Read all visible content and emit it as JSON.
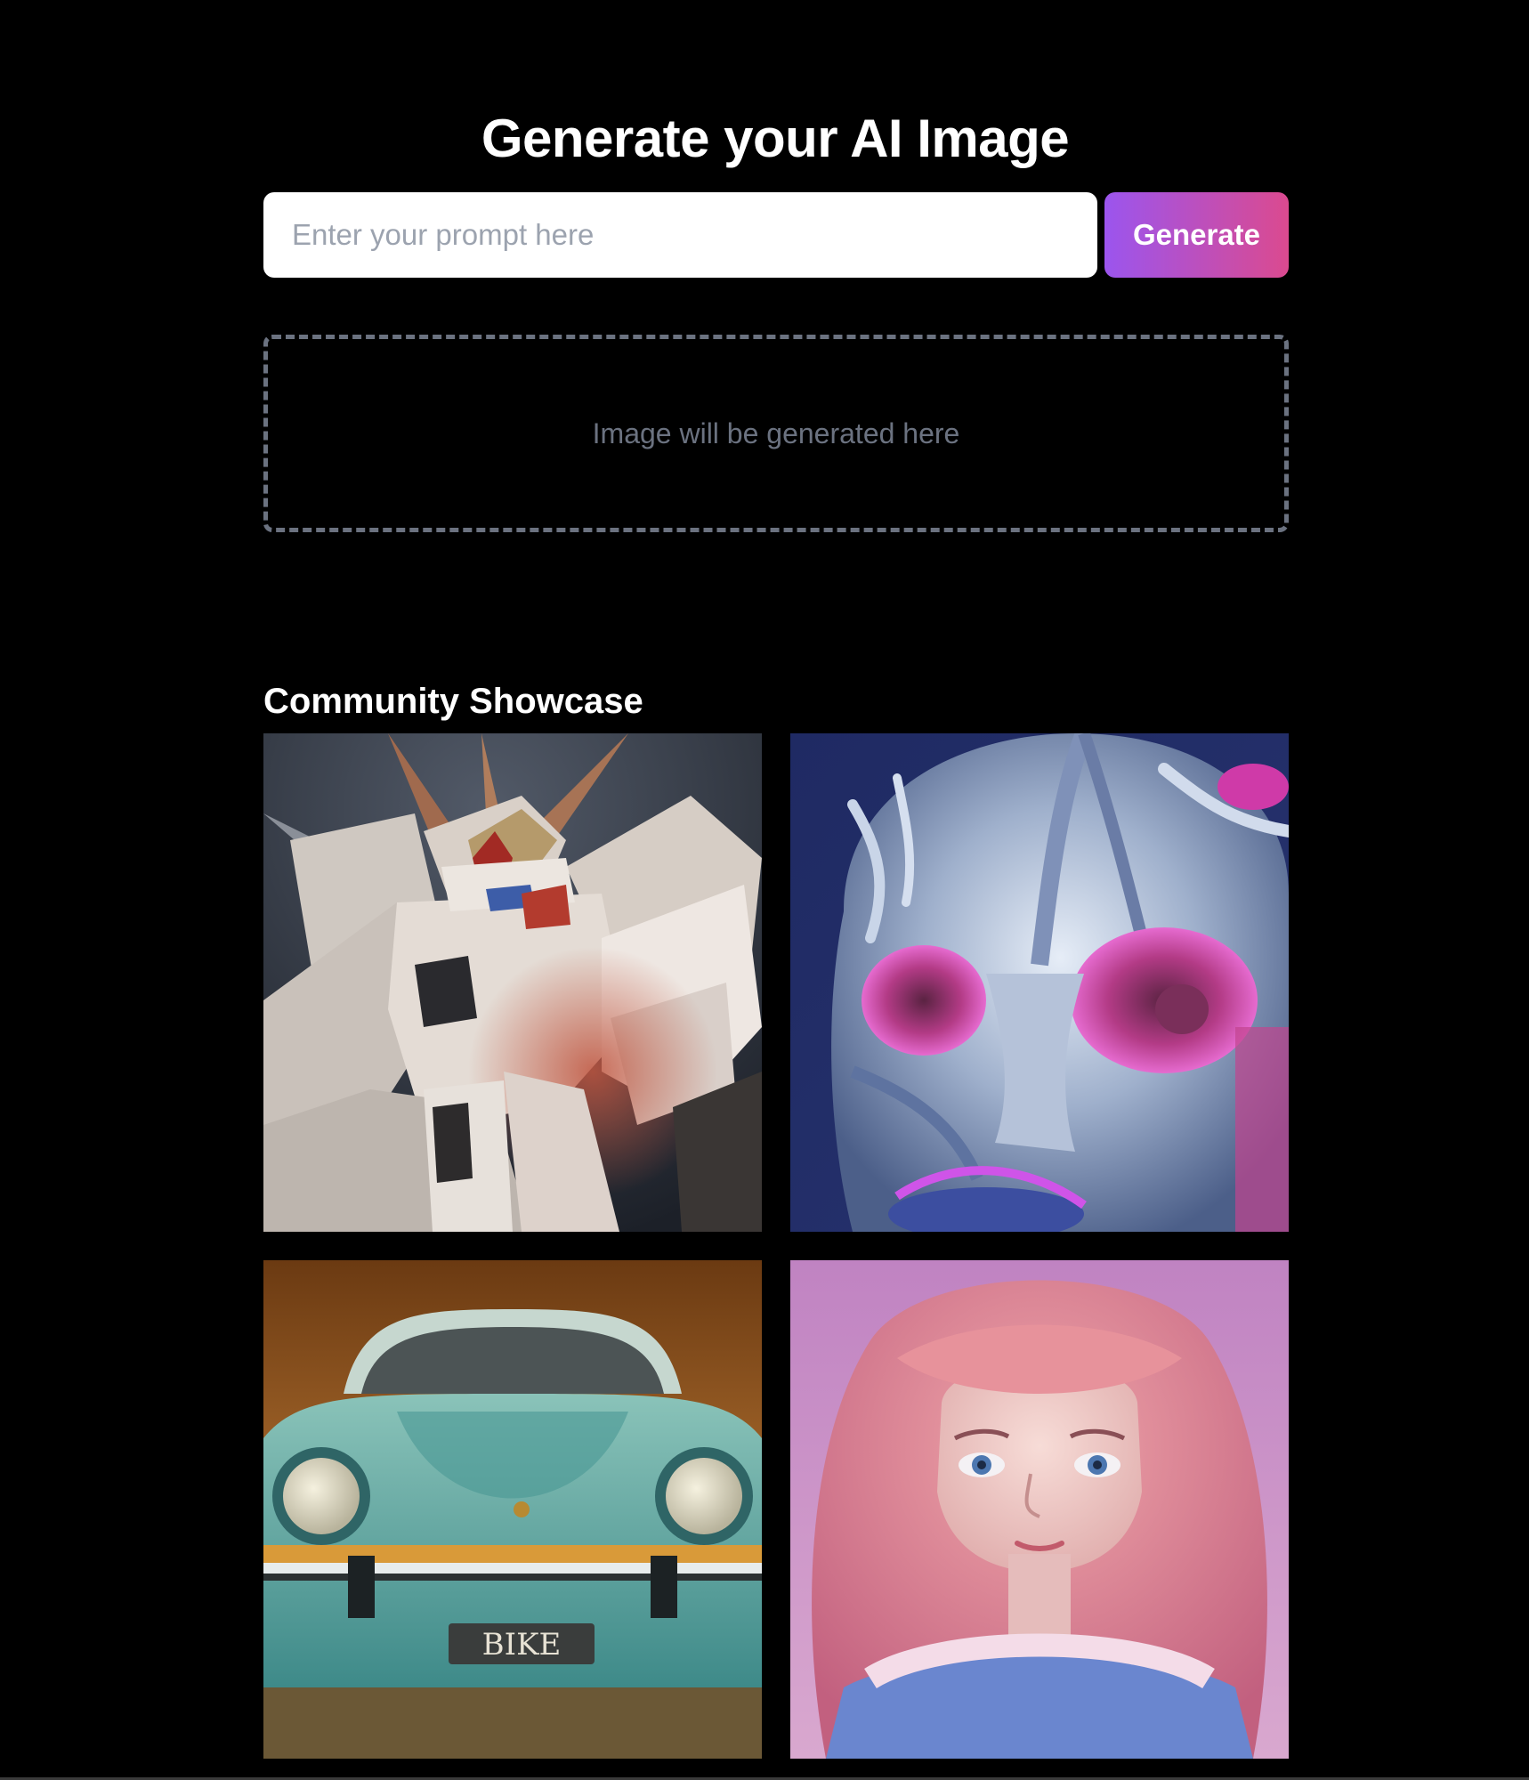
{
  "header": {
    "title": "Generate your AI Image"
  },
  "prompt": {
    "placeholder": "Enter your prompt here",
    "value": "",
    "button_label": "Generate"
  },
  "output": {
    "placeholder_text": "Image will be generated here"
  },
  "showcase": {
    "title": "Community Showcase",
    "items": [
      {
        "subject": "mecha robot"
      },
      {
        "subject": "chrome alien mask"
      },
      {
        "subject": "teal classic sports car",
        "plate_text": "BIKE"
      },
      {
        "subject": "pink-haired girl portrait"
      }
    ]
  },
  "colors": {
    "background": "#000000",
    "button_gradient_start": "#9b55ee",
    "button_gradient_end": "#db4a8f",
    "placeholder_border": "#6b7280"
  }
}
